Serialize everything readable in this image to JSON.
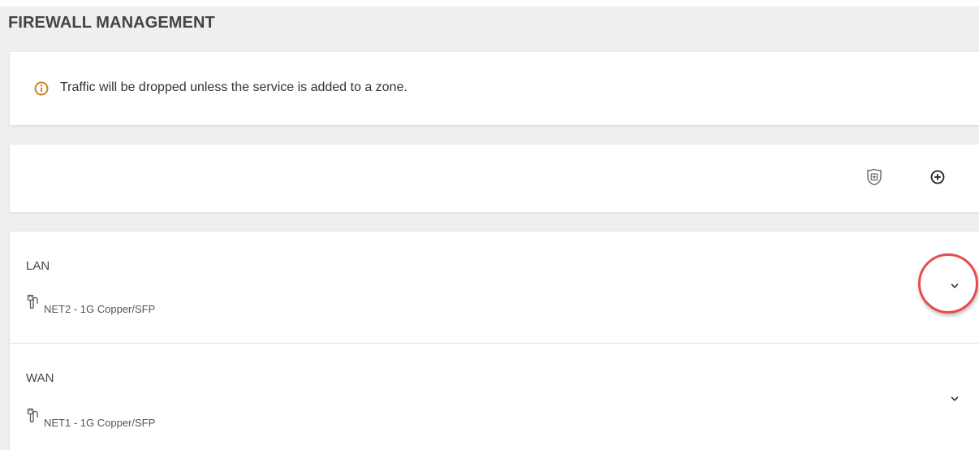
{
  "page": {
    "title": "FIREWALL MANAGEMENT"
  },
  "notice": {
    "icon": "info-icon",
    "text": "Traffic will be dropped unless the service is added to a zone.",
    "icon_color": "#c8861c"
  },
  "toolbar": {
    "icons": [
      "shield-zone-icon",
      "add-circle-icon"
    ]
  },
  "zones": [
    {
      "name": "LAN",
      "interface_icon": "ethernet-cable-icon",
      "interface": "NET2 - 1G Copper/SFP",
      "expand_icon": "chevron-down-icon",
      "highlighted": true
    },
    {
      "name": "WAN",
      "interface_icon": "ethernet-cable-icon",
      "interface": "NET1 - 1G Copper/SFP",
      "expand_icon": "chevron-down-icon",
      "highlighted": false
    }
  ],
  "colors": {
    "highlight": "#e74c4c",
    "background": "#efefef"
  }
}
